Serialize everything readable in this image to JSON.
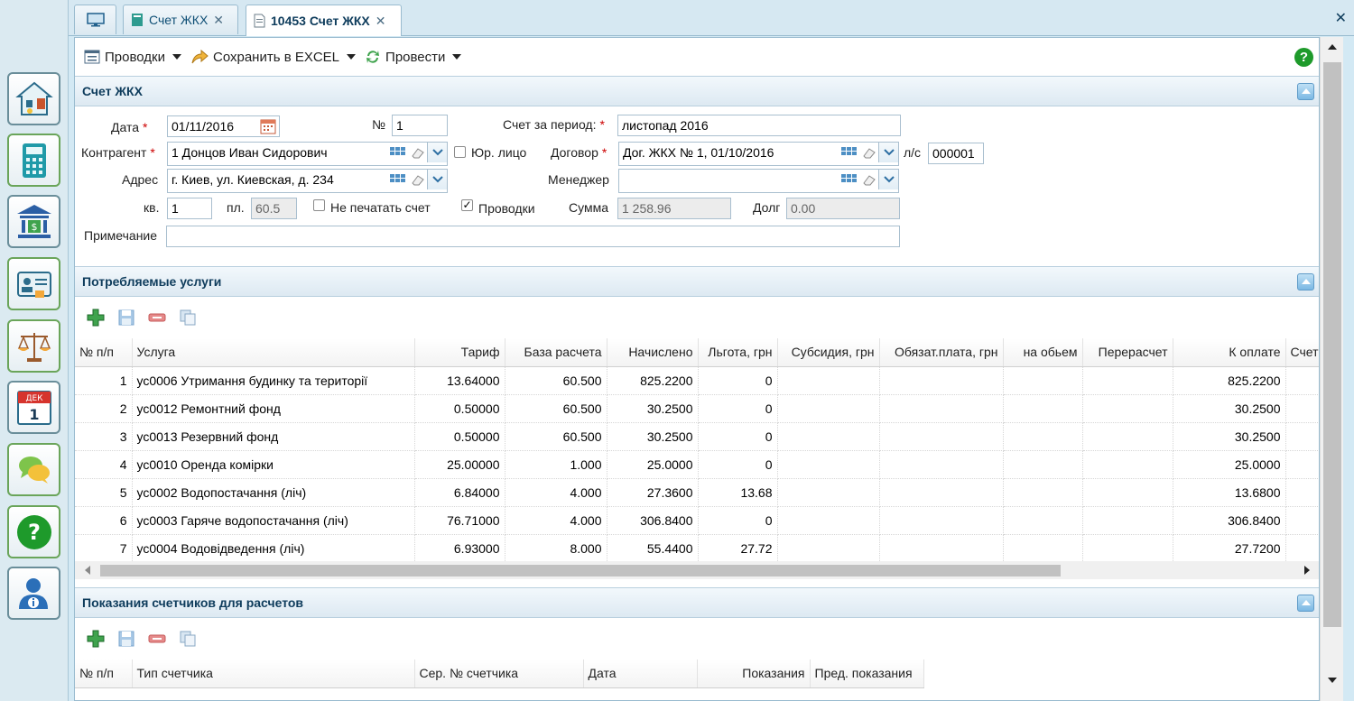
{
  "tabs": [
    {
      "label": ""
    },
    {
      "label": "Счет ЖКХ"
    },
    {
      "label": "10453 Счет ЖКХ"
    }
  ],
  "toolbar": {
    "postings_label": "Проводки",
    "excel_label": "Сохранить в EXCEL",
    "post_label": "Провести",
    "help_label": "?"
  },
  "sidebar": {
    "calendar_month": "ДЕК",
    "calendar_day": "1"
  },
  "invoice": {
    "section_title": "Счет ЖКХ",
    "date_label": "Дата",
    "date_value": "01/11/2016",
    "number_label": "№",
    "number_value": "1",
    "period_label": "Счет за период:",
    "period_value": "листопад 2016",
    "contractor_label": "Контрагент",
    "contractor_value": "1 Донцов Иван Сидорович",
    "legal_label": "Юр. лицо",
    "contract_label": "Договор",
    "contract_value": "Дог. ЖКХ № 1, 01/10/2016",
    "account_label": "л/с",
    "account_value": "000001",
    "address_label": "Адрес",
    "address_value": "г. Киев, ул. Киевская, д. 234",
    "manager_label": "Менеджер",
    "manager_value": "",
    "apt_label": "кв.",
    "apt_value": "1",
    "area_label": "пл.",
    "area_value": "60.5",
    "noprint_label": "Не печатать счет",
    "postings_chk_label": "Проводки",
    "postings_checked": true,
    "sum_label": "Сумма",
    "sum_value": "1 258.96",
    "debt_label": "Долг",
    "debt_value": "0.00",
    "note_label": "Примечание",
    "note_value": ""
  },
  "services": {
    "section_title": "Потребляемые услуги",
    "columns": [
      "№ п/п",
      "Услуга",
      "Тариф",
      "База расчета",
      "Начислено",
      "Льгота, грн",
      "Субсидия, грн",
      "Обязат.плата, грн",
      "на обьем",
      "Перерасчет",
      "К оплате",
      "Счет"
    ],
    "rows": [
      [
        "1",
        "ус0006 Утримання будинку та території",
        "13.64000",
        "60.500",
        "825.2200",
        "0",
        "",
        "",
        "",
        "",
        "825.2200",
        ""
      ],
      [
        "2",
        "ус0012 Ремонтний фонд",
        "0.50000",
        "60.500",
        "30.2500",
        "0",
        "",
        "",
        "",
        "",
        "30.2500",
        ""
      ],
      [
        "3",
        "ус0013 Резервний фонд",
        "0.50000",
        "60.500",
        "30.2500",
        "0",
        "",
        "",
        "",
        "",
        "30.2500",
        ""
      ],
      [
        "4",
        "ус0010 Оренда комірки",
        "25.00000",
        "1.000",
        "25.0000",
        "0",
        "",
        "",
        "",
        "",
        "25.0000",
        ""
      ],
      [
        "5",
        "ус0002 Водопостачання (ліч)",
        "6.84000",
        "4.000",
        "27.3600",
        "13.68",
        "",
        "",
        "",
        "",
        "13.6800",
        ""
      ],
      [
        "6",
        "ус0003 Гаряче водопостачання (ліч)",
        "76.71000",
        "4.000",
        "306.8400",
        "0",
        "",
        "",
        "",
        "",
        "306.8400",
        ""
      ],
      [
        "7",
        "ус0004 Водовідведення (ліч)",
        "6.93000",
        "8.000",
        "55.4400",
        "27.72",
        "",
        "",
        "",
        "",
        "27.7200",
        ""
      ]
    ]
  },
  "meters": {
    "section_title": "Показания счетчиков для расчетов",
    "columns": [
      "№ п/п",
      "Тип счетчика",
      "Сер. № счетчика",
      "Дата",
      "Показания",
      "Пред. показания"
    ]
  },
  "colors": {
    "accent": "#0e3c5c",
    "sidebar_bg": "#dbeaf1",
    "required": "#cc0000"
  }
}
